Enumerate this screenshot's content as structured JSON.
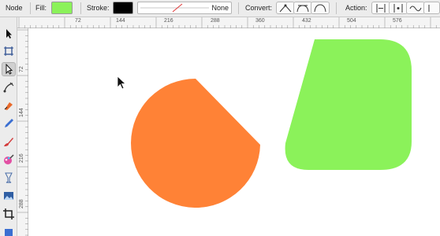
{
  "toolbar": {
    "mode_label": "Node",
    "fill_label": "Fill:",
    "fill_color": "#8BF25A",
    "stroke_label": "Stroke:",
    "stroke_color": "#000000",
    "stroke_none_label": "None",
    "convert_label": "Convert:",
    "action_label": "Action:"
  },
  "ruler": {
    "unit": "pt",
    "h_ticks": [
      "72",
      "144",
      "216",
      "288",
      "360",
      "432",
      "504",
      "576"
    ],
    "v_ticks": [
      "72",
      "144",
      "216",
      "288"
    ]
  },
  "tools": [
    {
      "name": "select-tool-icon"
    },
    {
      "name": "artboard-tool-icon"
    },
    {
      "name": "node-tool-icon",
      "active": true
    },
    {
      "name": "pen-tool-icon"
    },
    {
      "name": "fountain-pen-tool-icon"
    },
    {
      "name": "pencil-tool-icon"
    },
    {
      "name": "brush-tool-icon"
    },
    {
      "name": "color-picker-tool-icon"
    },
    {
      "name": "transparency-tool-icon"
    },
    {
      "name": "image-tool-icon"
    },
    {
      "name": "crop-tool-icon"
    },
    {
      "name": "fill-tool-icon"
    }
  ],
  "canvas": {
    "orange_shape_color": "#FF8236",
    "green_shape_color": "#8BF25A"
  }
}
